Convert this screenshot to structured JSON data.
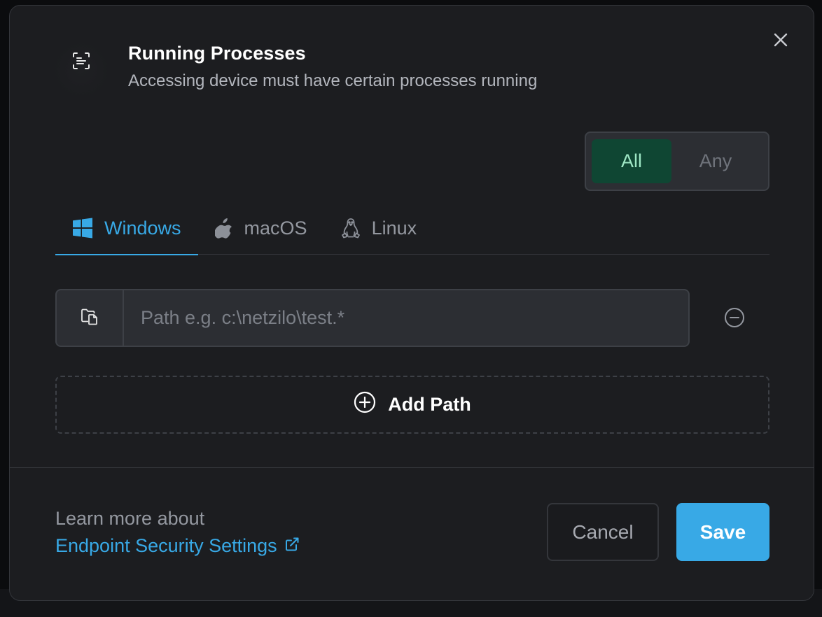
{
  "dialog": {
    "title": "Running Processes",
    "subtitle": "Accessing device must have certain processes running",
    "header_icon": "process-scan-icon",
    "close_icon": "close-icon"
  },
  "match_mode": {
    "options": [
      "All",
      "Any"
    ],
    "selected": "All"
  },
  "os_tabs": [
    {
      "label": "Windows",
      "icon": "windows-icon",
      "active": true
    },
    {
      "label": "macOS",
      "icon": "apple-icon",
      "active": false
    },
    {
      "label": "Linux",
      "icon": "linux-icon",
      "active": false
    }
  ],
  "path_entry": {
    "value": "",
    "placeholder": "Path e.g. c:\\netzilo\\test.*",
    "addon_icon": "folder-file-icon",
    "remove_icon": "minus-circle-icon"
  },
  "add_path": {
    "label": "Add Path",
    "icon": "plus-circle-icon"
  },
  "footer": {
    "learn_more": "Learn more about",
    "link_label": "Endpoint Security Settings",
    "link_icon": "external-link-icon",
    "cancel_label": "Cancel",
    "save_label": "Save"
  },
  "colors": {
    "accent": "#38a9e6",
    "active_segment_bg": "#0f4633",
    "active_segment_text": "#9ee6c4",
    "modal_bg": "#1c1d20"
  }
}
